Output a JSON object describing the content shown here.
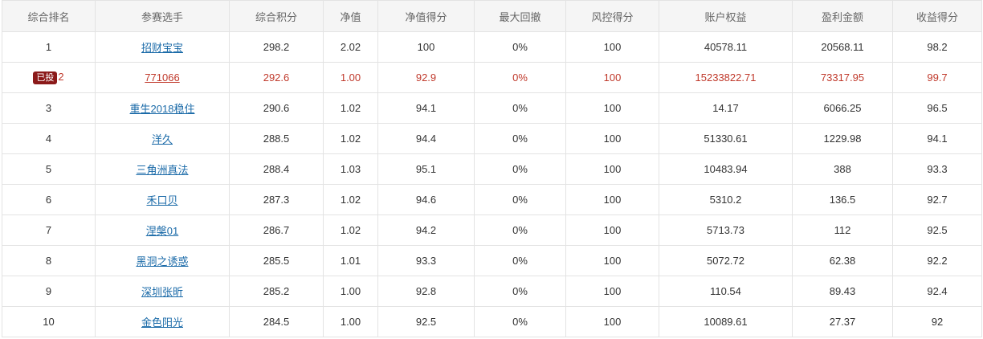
{
  "columns": [
    "综合排名",
    "参赛选手",
    "综合积分",
    "净值",
    "净值得分",
    "最大回撤",
    "风控得分",
    "账户权益",
    "盈利金额",
    "收益得分"
  ],
  "colors": {
    "link": "#1a6aa8",
    "highlight": "#c0392b",
    "badge_bg": "#8b1a1a",
    "header_bg": "#f5f5f5"
  },
  "rows": [
    {
      "rank": "1",
      "badge": "",
      "player": "招财宝宝",
      "score": "298.2",
      "nav": "2.02",
      "nav_score": "100",
      "drawdown": "0%",
      "risk_score": "100",
      "equity": "40578.11",
      "profit": "20568.11",
      "return_score": "98.2",
      "highlight": false
    },
    {
      "rank": "2",
      "badge": "已投",
      "player": "771066",
      "score": "292.6",
      "nav": "1.00",
      "nav_score": "92.9",
      "drawdown": "0%",
      "risk_score": "100",
      "equity": "15233822.71",
      "profit": "73317.95",
      "return_score": "99.7",
      "highlight": true
    },
    {
      "rank": "3",
      "badge": "",
      "player": "重生2018稳住",
      "score": "290.6",
      "nav": "1.02",
      "nav_score": "94.1",
      "drawdown": "0%",
      "risk_score": "100",
      "equity": "14.17",
      "profit": "6066.25",
      "return_score": "96.5",
      "highlight": false
    },
    {
      "rank": "4",
      "badge": "",
      "player": "洋久",
      "score": "288.5",
      "nav": "1.02",
      "nav_score": "94.4",
      "drawdown": "0%",
      "risk_score": "100",
      "equity": "51330.61",
      "profit": "1229.98",
      "return_score": "94.1",
      "highlight": false
    },
    {
      "rank": "5",
      "badge": "",
      "player": "三角洲真法",
      "score": "288.4",
      "nav": "1.03",
      "nav_score": "95.1",
      "drawdown": "0%",
      "risk_score": "100",
      "equity": "10483.94",
      "profit": "388",
      "return_score": "93.3",
      "highlight": false
    },
    {
      "rank": "6",
      "badge": "",
      "player": "禾口贝",
      "score": "287.3",
      "nav": "1.02",
      "nav_score": "94.6",
      "drawdown": "0%",
      "risk_score": "100",
      "equity": "5310.2",
      "profit": "136.5",
      "return_score": "92.7",
      "highlight": false
    },
    {
      "rank": "7",
      "badge": "",
      "player": "涅槃01",
      "score": "286.7",
      "nav": "1.02",
      "nav_score": "94.2",
      "drawdown": "0%",
      "risk_score": "100",
      "equity": "5713.73",
      "profit": "112",
      "return_score": "92.5",
      "highlight": false
    },
    {
      "rank": "8",
      "badge": "",
      "player": "黑洞之诱惑",
      "score": "285.5",
      "nav": "1.01",
      "nav_score": "93.3",
      "drawdown": "0%",
      "risk_score": "100",
      "equity": "5072.72",
      "profit": "62.38",
      "return_score": "92.2",
      "highlight": false
    },
    {
      "rank": "9",
      "badge": "",
      "player": "深圳张昕",
      "score": "285.2",
      "nav": "1.00",
      "nav_score": "92.8",
      "drawdown": "0%",
      "risk_score": "100",
      "equity": "110.54",
      "profit": "89.43",
      "return_score": "92.4",
      "highlight": false
    },
    {
      "rank": "10",
      "badge": "",
      "player": "金色阳光",
      "score": "284.5",
      "nav": "1.00",
      "nav_score": "92.5",
      "drawdown": "0%",
      "risk_score": "100",
      "equity": "10089.61",
      "profit": "27.37",
      "return_score": "92",
      "highlight": false
    }
  ]
}
